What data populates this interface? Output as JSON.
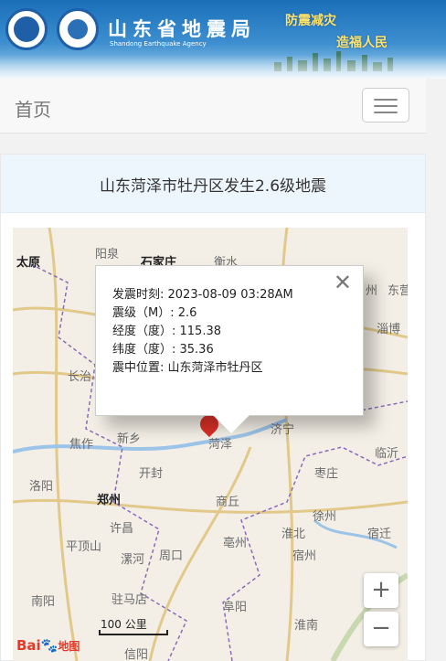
{
  "banner": {
    "title": "山东省地震局",
    "subtitle": "Shandong Earthquake Agency",
    "slogan_1": "防震减灾",
    "slogan_2": "造福人民"
  },
  "navbar": {
    "home_label": "首页"
  },
  "panel": {
    "title": "山东菏泽市牡丹区发生2.6级地震"
  },
  "popup": {
    "lines": [
      "发震时刻: 2023-08-09 03:28AM",
      "震级（M）: 2.6",
      "经度（度）: 115.38",
      "纬度（度）: 35.36",
      "震中位置: 山东菏泽市牡丹区"
    ],
    "close_glyph": "✕"
  },
  "map": {
    "cities": [
      "太原",
      "阳泉",
      "石家庄",
      "衡水",
      "州",
      "东营",
      "淄博",
      "长治",
      "济宁",
      "焦作",
      "新乡",
      "菏泽",
      "临沂",
      "洛阳",
      "开封",
      "枣庄",
      "郑州",
      "商丘",
      "徐州",
      "许昌",
      "淮北",
      "宿迁",
      "平顶山",
      "漯河",
      "周口",
      "亳州",
      "宿州",
      "南阳",
      "驻马店",
      "阜阳",
      "淮南",
      "信阳"
    ],
    "zoom_in": "+",
    "zoom_out": "−",
    "scale_label": "100 公里",
    "logo_text": "Bai",
    "logo_suffix": "地图"
  }
}
